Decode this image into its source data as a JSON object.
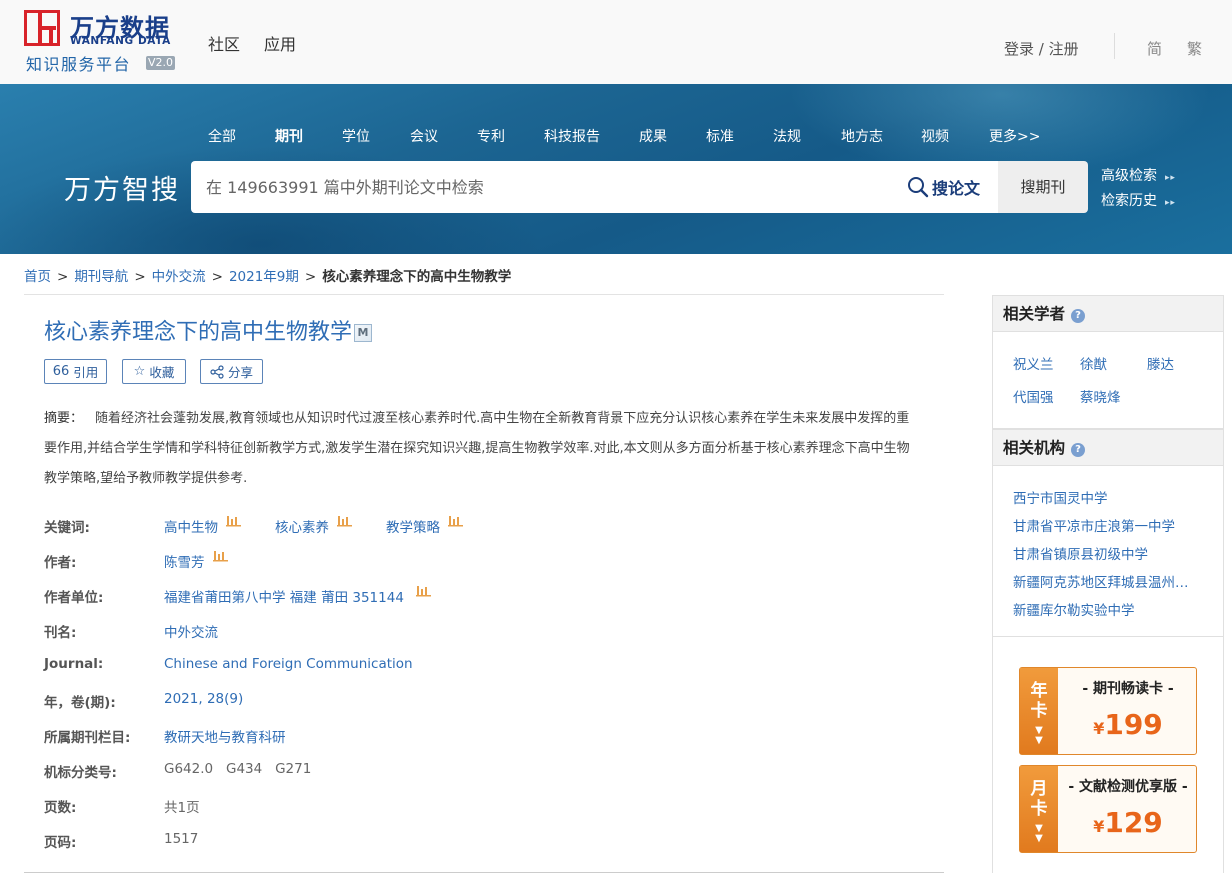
{
  "header": {
    "logo_cn": "万方数据",
    "logo_en": "WANFANG DATA",
    "logo_sub": "知识服务平台",
    "logo_version": "V2.0",
    "nav": [
      "社区",
      "应用"
    ],
    "login": "登录 / 注册",
    "lang_simplified": "简",
    "lang_traditional": "繁"
  },
  "search": {
    "categories": [
      "全部",
      "期刊",
      "学位",
      "会议",
      "专利",
      "科技报告",
      "成果",
      "标准",
      "法规",
      "地方志",
      "视频",
      "更多>>"
    ],
    "active_category": "期刊",
    "brand": "万方智搜",
    "placeholder": "在 149663991 篇中外期刊论文中检索",
    "search_paper_label": "搜论文",
    "search_journal_label": "搜期刊",
    "advanced": "高级检索",
    "history": "检索历史"
  },
  "breadcrumb": {
    "items": [
      "首页",
      "期刊导航",
      "中外交流",
      "2021年9期"
    ],
    "current": "核心素养理念下的高中生物教学",
    "separator": ">"
  },
  "article": {
    "title": "核心素养理念下的高中生物教学",
    "badge": "M",
    "actions": {
      "cite": "引用",
      "collect": "收藏",
      "share": "分享"
    },
    "abstract_label": "摘要：",
    "abstract": "随着经济社会蓬勃发展,教育领域也从知识时代过渡至核心素养时代.高中生物在全新教育背景下应充分认识核心素养在学生未来发展中发挥的重要作用,并结合学生学情和学科特征创新教学方式,激发学生潜在探究知识兴趣,提高生物教学效率.对此,本文则从多方面分析基于核心素养理念下高中生物教学策略,望给予教师教学提供参考.",
    "meta": {
      "keywords_label": "关键词:",
      "keywords": [
        "高中生物",
        "核心素养",
        "教学策略"
      ],
      "author_label": "作者:",
      "author": "陈雪芳",
      "affiliation_label": "作者单位:",
      "affiliation": "福建省莆田第八中学 福建 莆田 351144",
      "journal_label": "刊名:",
      "journal": "中外交流",
      "journal_en_label": "Journal:",
      "journal_en": "Chinese and Foreign Communication",
      "issue_label": "年，卷(期):",
      "issue": "2021, 28(9)",
      "column_label": "所属期刊栏目:",
      "column": "教研天地与教育科研",
      "class_label": "机标分类号:",
      "class_codes": "G642.0   G434   G271",
      "pages_label": "页数:",
      "pages": "共1页",
      "page_no_label": "页码:",
      "page_no": "1517"
    }
  },
  "sidebar": {
    "scholars_title": "相关学者",
    "scholars": [
      "祝义兰",
      "徐猷",
      "滕达",
      "代国强",
      "蔡晓烽"
    ],
    "orgs_title": "相关机构",
    "orgs": [
      "西宁市国灵中学",
      "甘肃省平凉市庄浪第一中学",
      "甘肃省镇原县初级中学",
      "新疆阿克苏地区拜城县温州中学",
      "新疆库尔勒实验中学"
    ],
    "cards": [
      {
        "tab": "年卡",
        "title": "- 期刊畅读卡 -",
        "currency": "¥",
        "price": "199"
      },
      {
        "tab": "月卡",
        "title": "- 文献检测优享版 -",
        "currency": "¥",
        "price": "129"
      }
    ]
  },
  "colors": {
    "link": "#2f6db5",
    "brand_red": "#d8232a",
    "brand_navy": "#1a3f8a",
    "banner": "#1c6592",
    "card_orange": "#e8651a"
  }
}
